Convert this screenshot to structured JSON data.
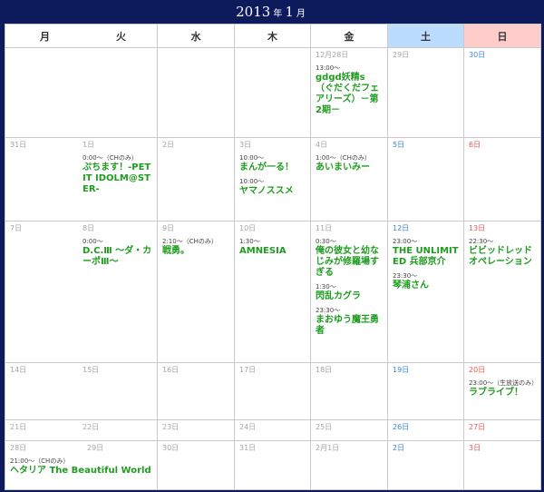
{
  "title": {
    "year": "2013",
    "year_unit": "年",
    "month": "1",
    "month_unit": "月"
  },
  "headers": [
    "月",
    "火",
    "水",
    "木",
    "金",
    "土",
    "日"
  ],
  "weeks": [
    [
      {
        "d": "",
        "ev": []
      },
      {
        "d": "",
        "ev": []
      },
      {
        "d": "",
        "ev": []
      },
      {
        "d": "12月28日",
        "ev": [
          {
            "t": "13:00～",
            "n": "gdgd妖精s（ぐだくだフェアリーズ）－第2期－"
          }
        ]
      },
      {
        "d": "29日",
        "ev": []
      },
      {
        "d": "30日",
        "ev": []
      }
    ],
    [
      {
        "d": "31日",
        "ev": []
      },
      {
        "d": "1日",
        "ev": [
          {
            "t": "0:00～（CHのみ）",
            "n": "ぷちます！-PETIT IDOLM@STER-"
          }
        ]
      },
      {
        "d": "2日",
        "ev": []
      },
      {
        "d": "3日",
        "ev": [
          {
            "t": "10:00～",
            "n": "まんが一る！"
          },
          {
            "t": "10:00～",
            "n": "ヤマノススメ"
          }
        ]
      },
      {
        "d": "4日",
        "ev": [
          {
            "t": "1:00～（CHのみ）",
            "n": "あいまいみー"
          }
        ]
      },
      {
        "d": "5日",
        "ev": []
      },
      {
        "d": "6日",
        "ev": []
      }
    ],
    [
      {
        "d": "7日",
        "ev": []
      },
      {
        "d": "8日",
        "ev": [
          {
            "t": "0:00～",
            "n": "D.C.Ⅲ ～ダ・カーポⅢ～"
          }
        ]
      },
      {
        "d": "9日",
        "ev": [
          {
            "t": "2:10～（CHのみ）",
            "n": "戦勇。"
          }
        ]
      },
      {
        "d": "10日",
        "ev": [
          {
            "t": "1:30～",
            "n": "AMNESIA"
          }
        ]
      },
      {
        "d": "11日",
        "ev": [
          {
            "t": "0:30～",
            "n": "俺の彼女と幼なじみが修羅場すぎる"
          },
          {
            "t": "1:30～",
            "n": "閃乱カグラ"
          },
          {
            "t": "23:30～",
            "n": "まおゆう魔王勇者"
          }
        ]
      },
      {
        "d": "12日",
        "ev": [
          {
            "t": "23:00～",
            "n": "THE UNLIMITED 兵部京介"
          },
          {
            "t": "23:30～",
            "n": "琴浦さん"
          }
        ]
      },
      {
        "d": "13日",
        "ev": [
          {
            "t": "22:30～",
            "n": "ビビッドレッド オペレーション"
          }
        ]
      }
    ],
    [
      {
        "d": "14日",
        "ev": []
      },
      {
        "d": "15日",
        "ev": []
      },
      {
        "d": "16日",
        "ev": []
      },
      {
        "d": "17日",
        "ev": []
      },
      {
        "d": "18日",
        "ev": []
      },
      {
        "d": "19日",
        "ev": []
      },
      {
        "d": "20日",
        "ev": [
          {
            "t": "23:00～（生放送のみ）",
            "n": "ラブライブ！"
          }
        ]
      }
    ],
    [
      {
        "d": "21日",
        "ev": []
      },
      {
        "d": "22日",
        "ev": []
      },
      {
        "d": "23日",
        "ev": []
      },
      {
        "d": "24日",
        "ev": []
      },
      {
        "d": "25日",
        "ev": []
      },
      {
        "d": "26日",
        "ev": []
      },
      {
        "d": "27日",
        "ev": []
      }
    ],
    [
      {
        "d": "28日",
        "ev": [
          {
            "t": "21:00～（CHのみ）",
            "n": "ヘタリア The Beautiful World"
          }
        ]
      },
      {
        "d": "29日",
        "ev": []
      },
      {
        "d": "30日",
        "ev": []
      },
      {
        "d": "31日",
        "ev": []
      },
      {
        "d": "2月1日",
        "ev": []
      },
      {
        "d": "2日",
        "ev": []
      },
      {
        "d": "3日",
        "ev": []
      }
    ]
  ]
}
